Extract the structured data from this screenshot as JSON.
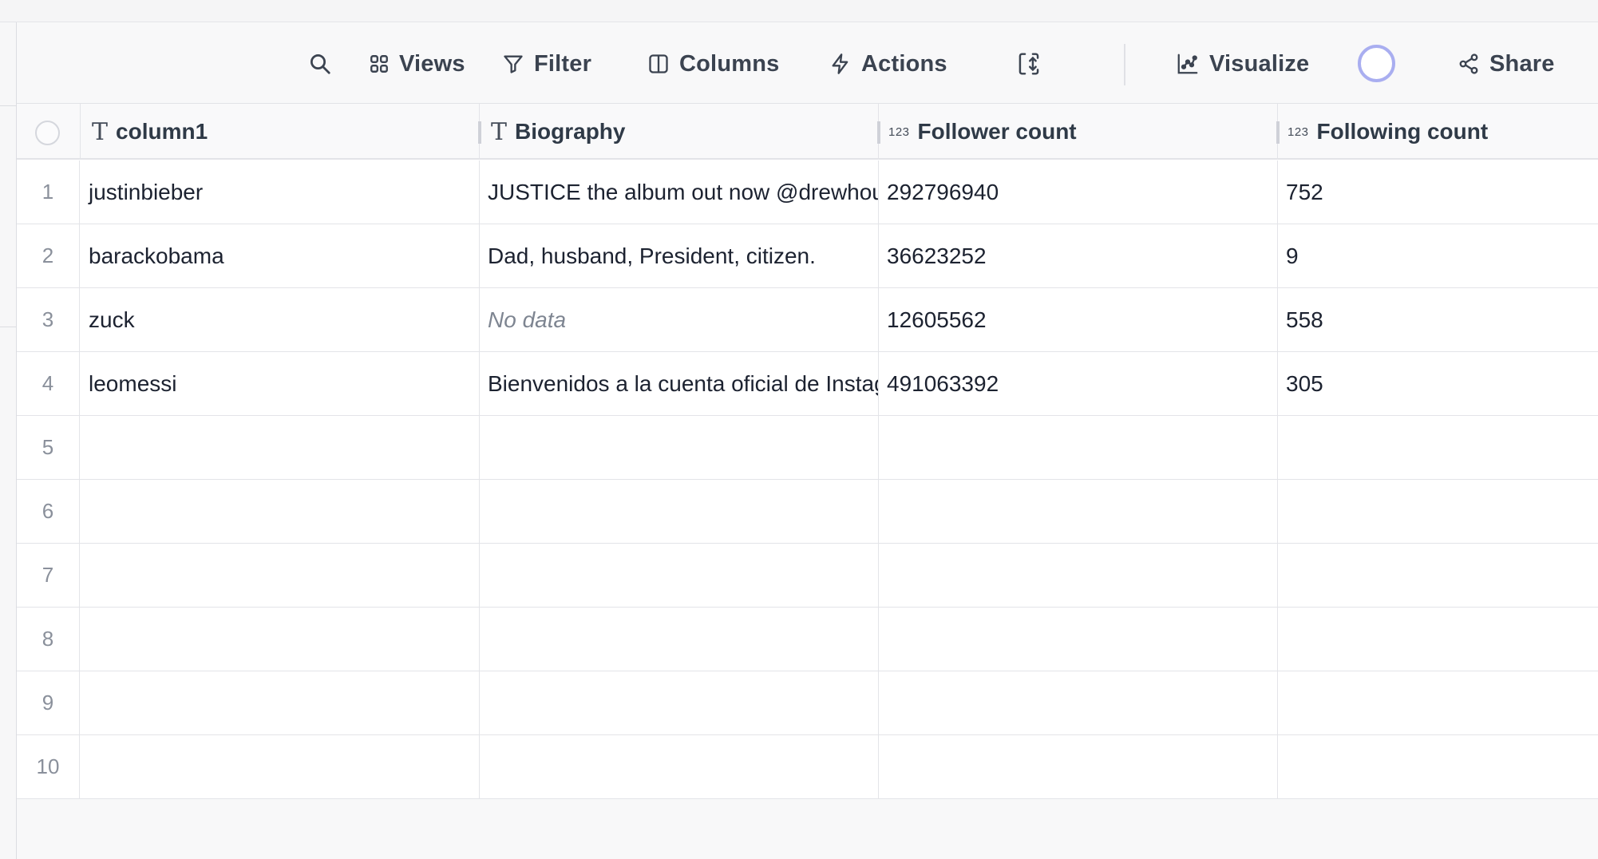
{
  "toolbar": {
    "views_label": "Views",
    "filter_label": "Filter",
    "columns_label": "Columns",
    "actions_label": "Actions",
    "visualize_label": "Visualize",
    "share_label": "Share"
  },
  "columns": [
    {
      "label": "column1",
      "type_icon": "T"
    },
    {
      "label": "Biography",
      "type_icon": "T"
    },
    {
      "label": "Follower count",
      "type_icon": "123"
    },
    {
      "label": "Following count",
      "type_icon": "123"
    }
  ],
  "rows": [
    {
      "num": "1",
      "c1": "justinbieber",
      "c2": "JUSTICE the album out now @drewhouse",
      "c3": "292796940",
      "c4": "752"
    },
    {
      "num": "2",
      "c1": "barackobama",
      "c2": "Dad, husband, President, citizen.",
      "c3": "36623252",
      "c4": "9"
    },
    {
      "num": "3",
      "c1": "zuck",
      "c2": "No data",
      "c3": "12605562",
      "c4": "558"
    },
    {
      "num": "4",
      "c1": "leomessi",
      "c2": "Bienvenidos a la cuenta oficial de Instagram",
      "c3": "491063392",
      "c4": "305"
    },
    {
      "num": "5",
      "c1": "",
      "c2": "",
      "c3": "",
      "c4": ""
    },
    {
      "num": "6",
      "c1": "",
      "c2": "",
      "c3": "",
      "c4": ""
    },
    {
      "num": "7",
      "c1": "",
      "c2": "",
      "c3": "",
      "c4": ""
    },
    {
      "num": "8",
      "c1": "",
      "c2": "",
      "c3": "",
      "c4": ""
    },
    {
      "num": "9",
      "c1": "",
      "c2": "",
      "c3": "",
      "c4": ""
    },
    {
      "num": "10",
      "c1": "",
      "c2": "",
      "c3": "",
      "c4": ""
    }
  ],
  "colors": {
    "accent_spinner": "#a9aef0",
    "grid_line": "#e3e4e8",
    "no_data_text": "#7e8591"
  }
}
